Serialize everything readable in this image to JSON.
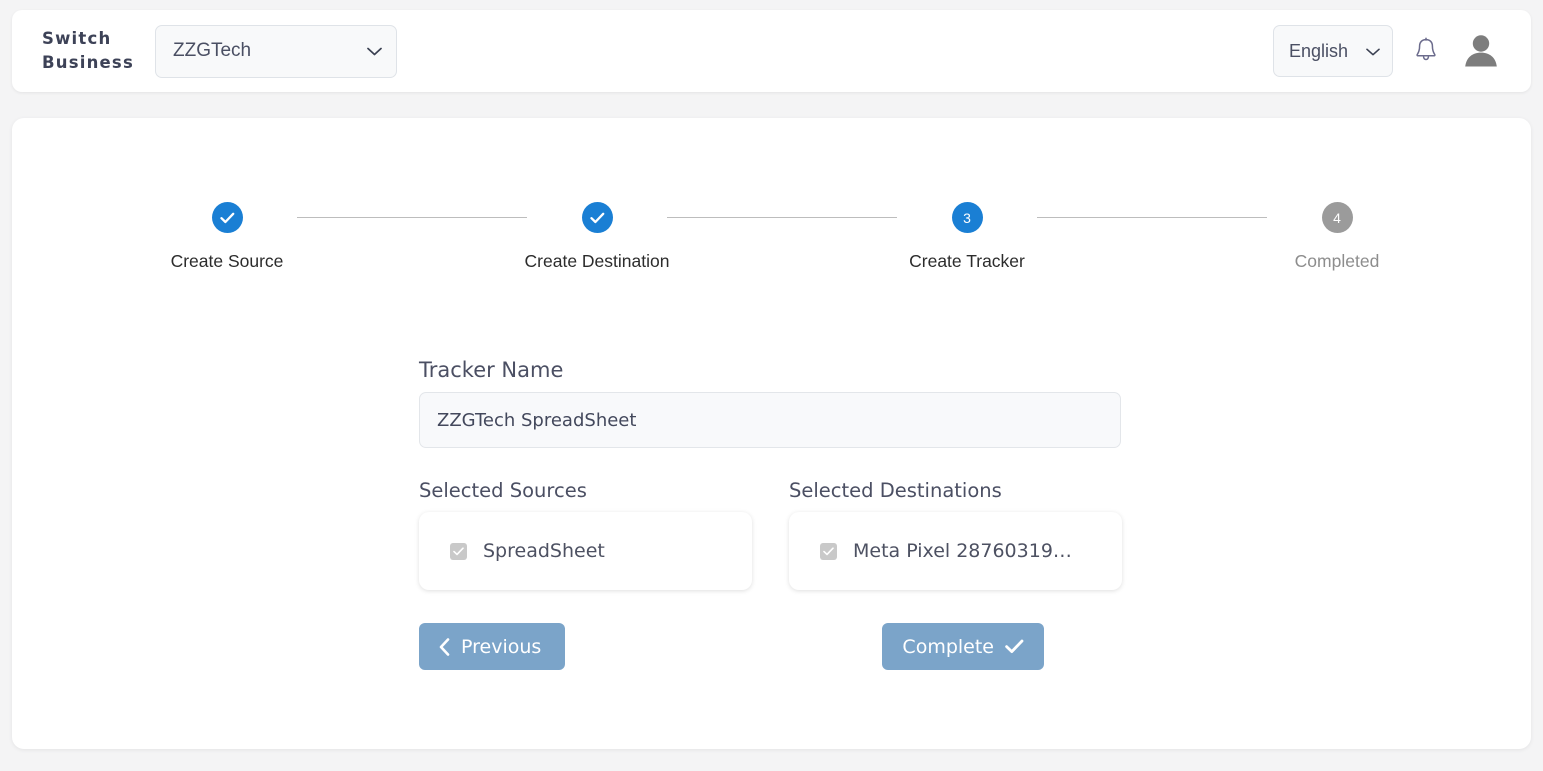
{
  "header": {
    "switch_business_label": "Switch Business",
    "business_select": {
      "value": "ZZGTech",
      "icon": "chevron-down-icon"
    },
    "language_select": {
      "value": "English",
      "icon": "chevron-down-icon"
    },
    "notifications_icon": "bell-icon",
    "account_icon": "avatar-icon"
  },
  "stepper": {
    "steps": [
      {
        "marker": "✓",
        "label": "Create Source",
        "state": "done"
      },
      {
        "marker": "✓",
        "label": "Create Destination",
        "state": "done"
      },
      {
        "marker": "3",
        "label": "Create Tracker",
        "state": "active"
      },
      {
        "marker": "4",
        "label": "Completed",
        "state": "todo"
      }
    ]
  },
  "form": {
    "tracker_name": {
      "label": "Tracker Name",
      "value": "ZZGTech SpreadSheet",
      "placeholder": "Tracker Name"
    },
    "sources": {
      "label": "Selected Sources",
      "items": [
        {
          "name": "SpreadSheet",
          "checked": true
        }
      ]
    },
    "destinations": {
      "label": "Selected Destinations",
      "items": [
        {
          "name": "Meta Pixel 28760319…",
          "checked": true
        }
      ]
    },
    "buttons": {
      "previous": {
        "label": "Previous",
        "icon": "chevron-left-icon"
      },
      "complete": {
        "label": "Complete",
        "icon": "check-icon"
      }
    }
  },
  "colors": {
    "page_bg": "#f4f4f5",
    "card_bg": "#ffffff",
    "step_active": "#1a7fd4",
    "step_todo": "#9b9b9b",
    "button": "#7ba4c9",
    "text": "#4b4f63"
  }
}
